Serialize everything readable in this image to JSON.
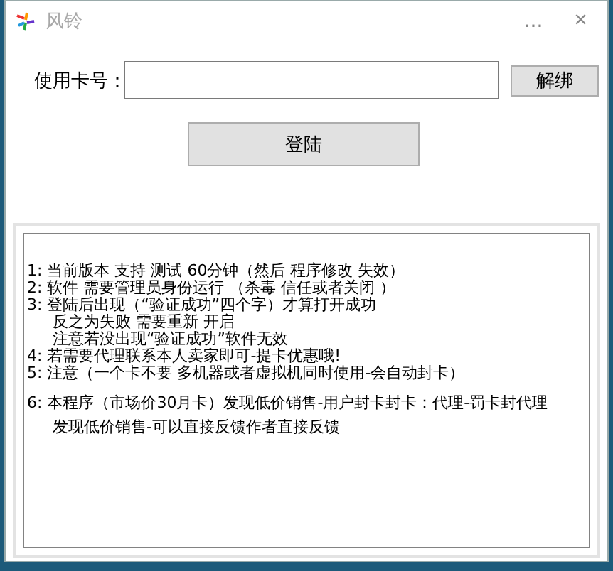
{
  "window": {
    "title": "风铃",
    "buttons": [
      "...",
      "×"
    ]
  },
  "card_field": {
    "label": "使用卡号："
  },
  "unbind_button": "解绑",
  "login_button": "登陆",
  "notice_lines": [
    {
      "text": "1: 当前版本  支持 测试 60分钟（然后 程序修改 失效）",
      "indent": false
    },
    {
      "text": "2: 软件 需要管理员身份运行 （杀毒 信任或者关闭 ）",
      "indent": false
    },
    {
      "text": "3: 登陆后出现（“验证成功”四个字）才算打开成功",
      "indent": false
    },
    {
      "text": "反之为失败 需要重新 开启",
      "indent": true
    },
    {
      "text": "注意若没出现“验证成功”软件无效",
      "indent": true
    },
    {
      "text": "4: 若需要代理联系本人卖家即可-提卡优惠哦!",
      "indent": false
    },
    {
      "text": "5: 注意（一个卡不要 多机器或者虚拟机同时使用-会自动封卡）",
      "indent": false
    },
    {
      "text": "6: 本程序（市场价30月卡）发现低价销售-用户封卡封卡：代理-罚卡封代理",
      "indent": false,
      "gap": true
    },
    {
      "text": "发现低价销售-可以直接反馈作者直接反馈",
      "indent": true
    }
  ]
}
